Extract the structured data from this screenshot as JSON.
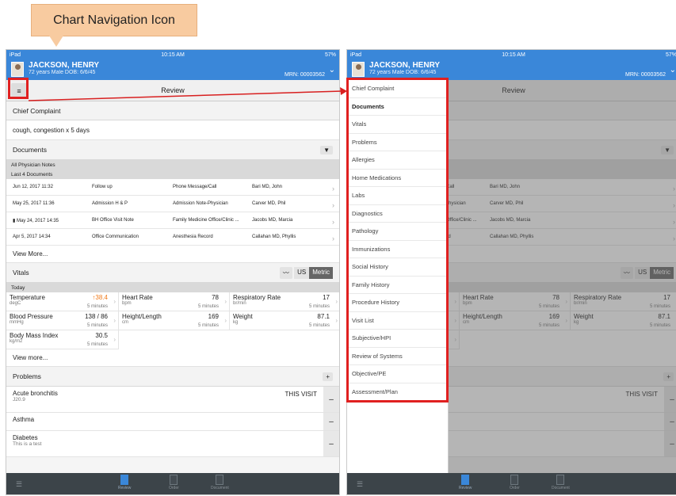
{
  "callout": "Chart Navigation Icon",
  "status": {
    "left": "iPad",
    "time": "10:15 AM",
    "right": "57%"
  },
  "patient": {
    "name": "JACKSON, HENRY",
    "meta": "72 years  Male  DOB: 6/6/45",
    "mrn": "MRN: 00003562"
  },
  "toolbar": {
    "title": "Review"
  },
  "chief": {
    "header": "Chief Complaint",
    "text": "cough, congestion x 5 days"
  },
  "documents": {
    "header": "Documents",
    "filter": "All Physician Notes",
    "sub": "Last 4 Documents",
    "rows": [
      [
        "Jun 12, 2017 11:32",
        "Follow up",
        "Phone Message/Call",
        "Bari MD, John"
      ],
      [
        "May 25, 2017 11:36",
        "Admission H & P",
        "Admission Note-Physician",
        "Carver MD, Phil"
      ],
      [
        "May 24, 2017 14:35",
        "BH Office Visit Note",
        "Family Medicine Office/Clinic ...",
        "Jacobs MD, Marcia"
      ],
      [
        "Apr 5, 2017 14:34",
        "Office Communication",
        "Anesthesia Record",
        "Callahan MD, Phyllis"
      ]
    ],
    "more": "View More..."
  },
  "vitals": {
    "header": "Vitals",
    "us": "US",
    "metric": "Metric",
    "today": "Today",
    "more": "View more...",
    "cells": [
      {
        "label": "Temperature",
        "unit": "degC",
        "value": "38.4",
        "time": "5 minutes"
      },
      {
        "label": "Heart Rate",
        "unit": "bpm",
        "value": "78",
        "time": "5 minutes"
      },
      {
        "label": "Respiratory Rate",
        "unit": "br/min",
        "value": "17",
        "time": "5 minutes"
      },
      {
        "label": "Blood Pressure",
        "unit": "mmHg",
        "value": "138 / 86",
        "time": "5 minutes"
      },
      {
        "label": "Height/Length",
        "unit": "cm",
        "value": "169",
        "time": "5 minutes"
      },
      {
        "label": "Weight",
        "unit": "kg",
        "value": "87.1",
        "time": "5 minutes"
      },
      {
        "label": "Body Mass Index",
        "unit": "kg/m2",
        "value": "30.5",
        "time": "5 minutes"
      }
    ]
  },
  "problems": {
    "header": "Problems",
    "items": [
      {
        "name": "Acute bronchitis",
        "code": "J20.9",
        "tag": "THIS VISIT"
      },
      {
        "name": "Asthma",
        "code": "",
        "tag": ""
      },
      {
        "name": "Diabetes",
        "code": "This is a test",
        "tag": ""
      }
    ]
  },
  "tabs": [
    "Review",
    "Order",
    "Document"
  ],
  "nav": [
    "Chief Complaint",
    "Documents",
    "Vitals",
    "Problems",
    "Allergies",
    "Home Medications",
    "Labs",
    "Diagnostics",
    "Pathology",
    "Immunizations",
    "Social History",
    "Family History",
    "Procedure History",
    "Visit List",
    "Subjective/HPI",
    "Review of Systems",
    "Objective/PE",
    "Assessment/Plan"
  ],
  "colors": {
    "header": "#3a87d9",
    "highlight": "#e02020",
    "callout": "#f8cba0",
    "temp_alert": "#f07a1a"
  }
}
